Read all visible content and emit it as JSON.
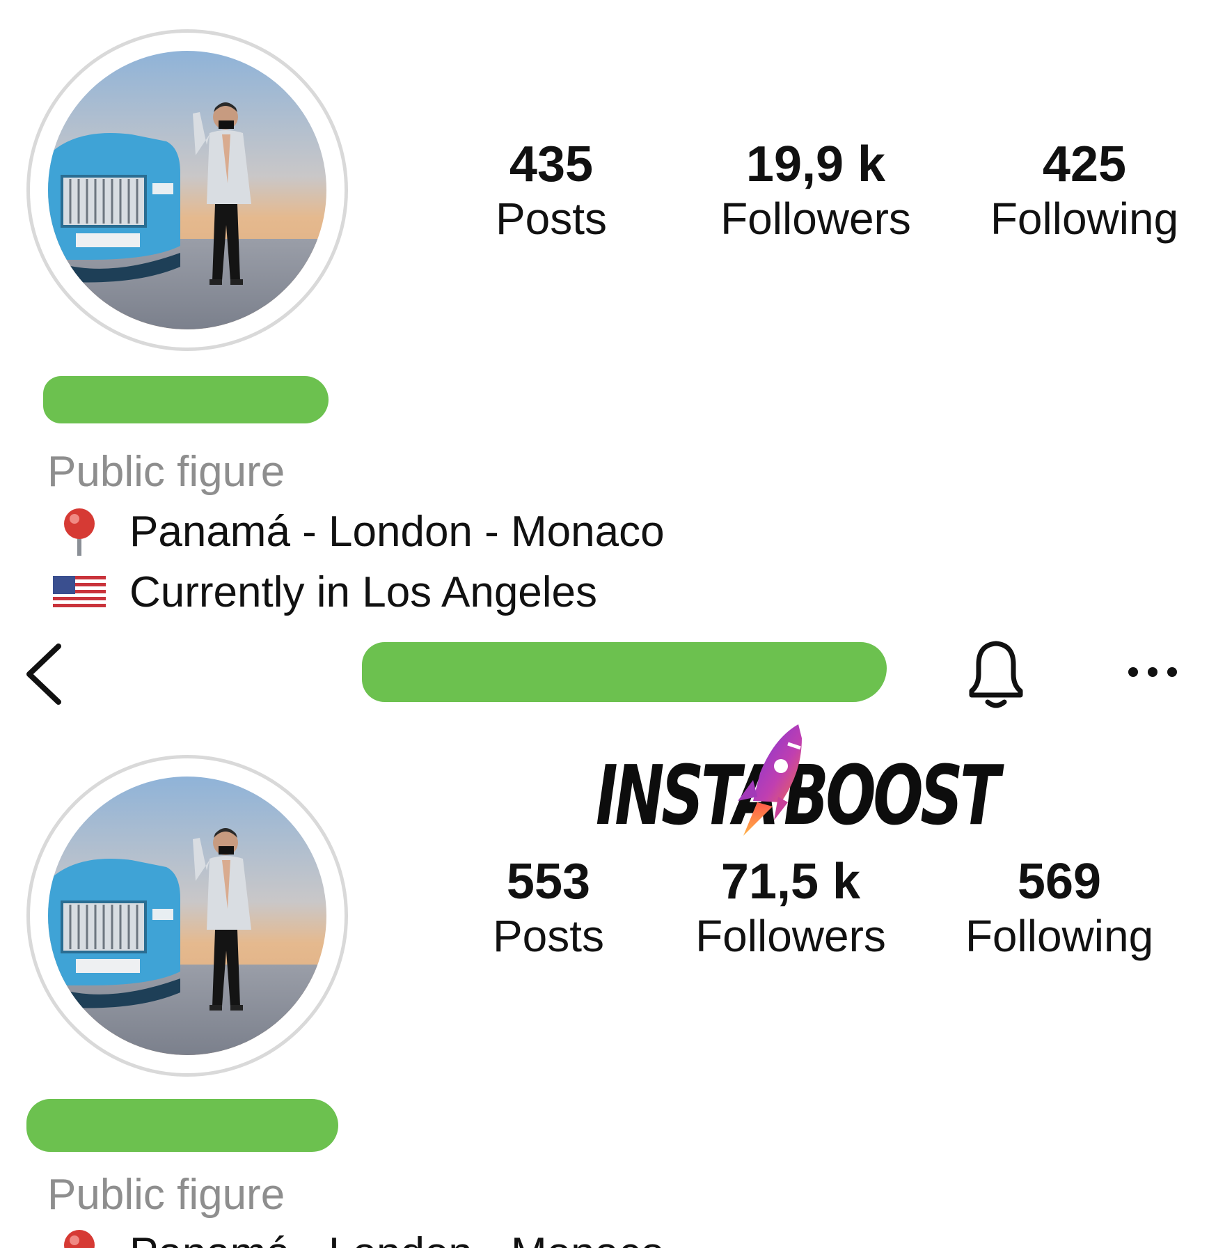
{
  "before": {
    "stats": [
      {
        "value": "435",
        "label": "Posts"
      },
      {
        "value": "19,9 k",
        "label": "Followers"
      },
      {
        "value": "425",
        "label": "Following"
      }
    ],
    "category": "Public figure",
    "bio": [
      {
        "icon": "round-pushpin-emoji",
        "text": "Panamá - London - Monaco"
      },
      {
        "icon": "us-flag-emoji",
        "text": "Currently in Los Angeles"
      }
    ]
  },
  "header": {
    "back_icon": "chevron-left-icon",
    "notification_icon": "bell-icon",
    "more_icon": "more-horizontal-icon"
  },
  "watermark": {
    "text_left": "INSTA",
    "text_right": "BOOST",
    "icon": "rocket-icon"
  },
  "after": {
    "stats": [
      {
        "value": "553",
        "label": "Posts"
      },
      {
        "value": "71,5 k",
        "label": "Followers"
      },
      {
        "value": "569",
        "label": "Following"
      }
    ],
    "category": "Public figure",
    "bio": [
      {
        "icon": "round-pushpin-emoji",
        "text": "Panamá - London - Monaco"
      }
    ]
  },
  "colors": {
    "redaction": "#6cc14f",
    "category_gray": "#8e8e8e",
    "avatar_ring": "#d9d9d9"
  }
}
